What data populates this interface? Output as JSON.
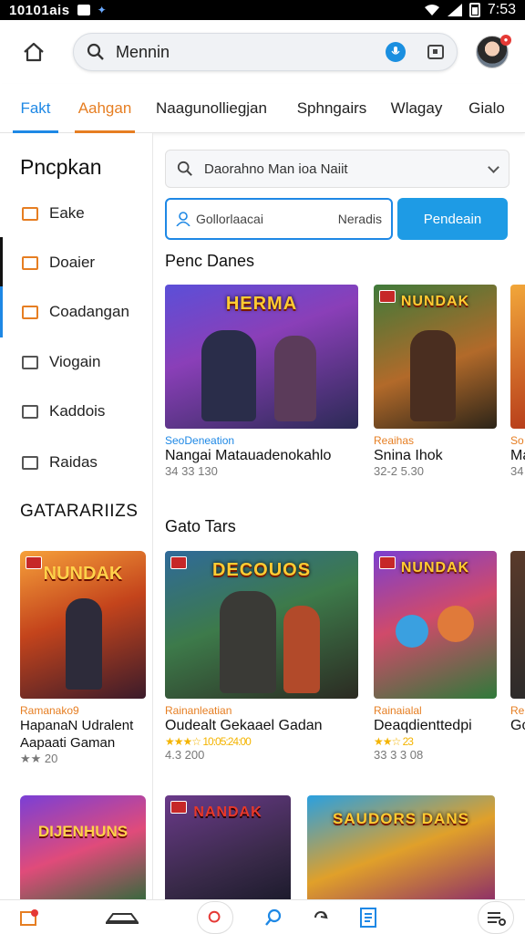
{
  "status_bar": {
    "left_text": "10101ais",
    "time": "7:53"
  },
  "search": {
    "query": "Mennin"
  },
  "tabs": [
    {
      "label": "Fakt"
    },
    {
      "label": "Aahgan"
    },
    {
      "label": "Naagunolliegjan"
    },
    {
      "label": "Sphngairs"
    },
    {
      "label": "Wlagay"
    },
    {
      "label": "Gialo"
    }
  ],
  "sidebar": {
    "title": "Pncpkan",
    "items": [
      {
        "label": "Eake",
        "icon": "calendar-icon"
      },
      {
        "label": "Doaier",
        "icon": "folder-icon"
      },
      {
        "label": "Coadangan",
        "icon": "list-icon"
      },
      {
        "label": "Viogain",
        "icon": "edit-icon"
      },
      {
        "label": "Kaddois",
        "icon": "edit-icon"
      },
      {
        "label": "Raidas",
        "icon": "table-icon"
      }
    ],
    "section_title": "GATARARIIZS",
    "cards": [
      {
        "art_title": "NUNDAK",
        "tag": "Ramanako9",
        "title": "HapanaN Udralent Aapaati Gaman",
        "sub": "★★ 20"
      },
      {
        "art_title": "DIJENHUNS"
      }
    ]
  },
  "main": {
    "filter_select": "Daorahno Man ioa Naiit",
    "segment": {
      "left": "Gollorlaacai",
      "right": "Neradis"
    },
    "primary_button": "Pendeain",
    "section1_title": "Penc Danes",
    "row1": [
      {
        "art_title": "HERMA",
        "tag": "SeoDeneation",
        "title": "Nangai Matauadenokahlo",
        "sub": "34 33 130"
      },
      {
        "art_title": "NUNDAK",
        "tag": "Reaihas",
        "title": "Snina Ihok",
        "sub": "32-2 5.30"
      },
      {
        "tag": "So",
        "title": "Ma",
        "sub": "34"
      }
    ],
    "section2_title": "Gato Tars",
    "row2": [
      {
        "art_title": "DECOUOS",
        "tag": "Rainanleatian",
        "title": "Oudealt Gekaael Gadan",
        "sub": "4.3 200",
        "stars": "★★★☆ 10:05:24:00"
      },
      {
        "art_title": "NUNDAK",
        "tag": "Rainaialal",
        "title": "Deaqdienttedpi",
        "sub": "33 3 3 08",
        "stars": "★★☆ 23"
      },
      {
        "tag": "Re",
        "title": "Gc"
      }
    ],
    "row3": [
      {
        "art_title": "NANDAK"
      },
      {
        "art_title": "SAUDORS DANS"
      }
    ]
  },
  "colors": {
    "accent": "#1e88e5",
    "orange": "#e67e22",
    "button": "#1e9be5"
  }
}
